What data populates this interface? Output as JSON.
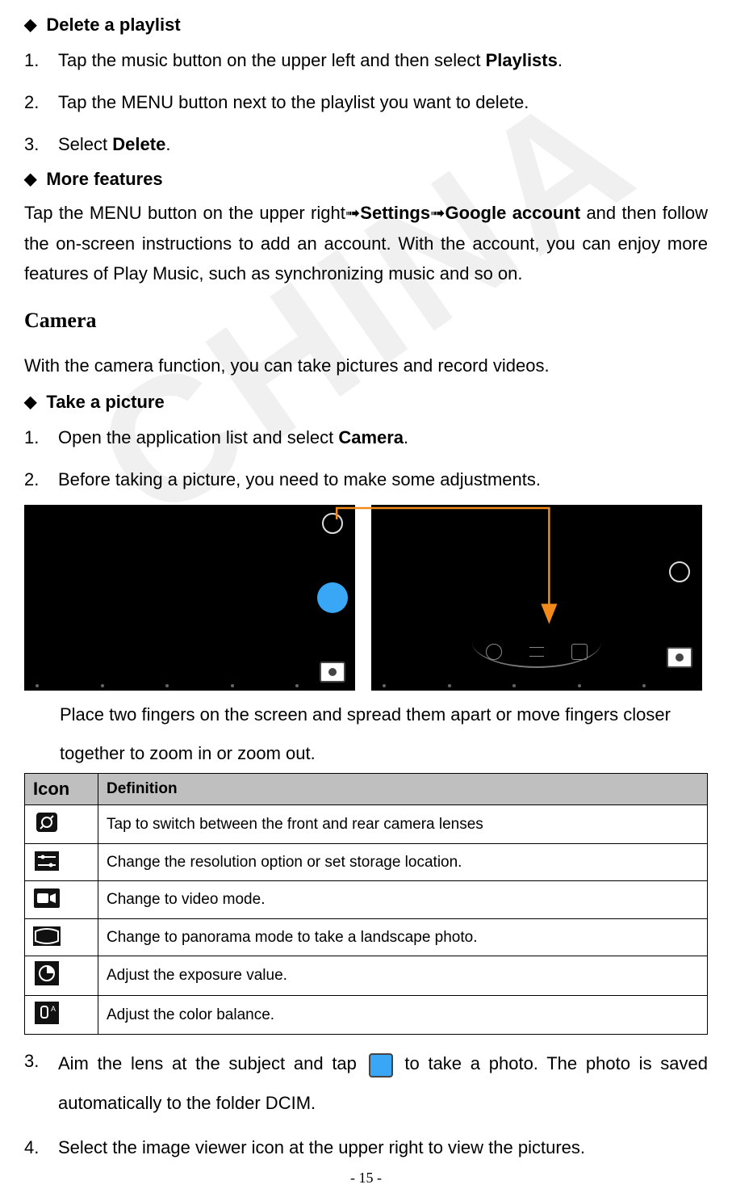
{
  "section_delete": {
    "title": "Delete a playlist",
    "steps": [
      {
        "num": "1.",
        "pre": "Tap the music button on the upper left and then select ",
        "bold": "Playlists",
        "post": "."
      },
      {
        "num": "2.",
        "pre": "Tap the MENU button next to the playlist you want to delete.",
        "bold": "",
        "post": ""
      },
      {
        "num": "3.",
        "pre": "Select ",
        "bold": "Delete",
        "post": "."
      }
    ]
  },
  "section_more": {
    "title": "More features",
    "para_pre": "Tap the MENU button on the upper right",
    "arrow": "➟",
    "b1": "Settings",
    "b2": "Google account",
    "para_post": " and then follow the on-screen instructions to add an account. With the account, you can enjoy more features of Play Music, such as synchronizing music and so on."
  },
  "section_camera": {
    "h": "Camera",
    "intro": "With the camera function, you can take pictures and record videos.",
    "take_title": "Take a picture",
    "steps": [
      {
        "num": "1.",
        "pre": "Open the application list and select ",
        "bold": "Camera",
        "post": "."
      },
      {
        "num": "2.",
        "pre": "Before taking a picture, you need to make some adjustments.",
        "bold": "",
        "post": ""
      }
    ],
    "zoom_note_l1": "Place two fingers on the screen and spread them apart or move fingers closer",
    "zoom_note_l2": "together to zoom in or zoom out.",
    "table": {
      "head_icon": "Icon",
      "head_def": "Definition",
      "rows": [
        {
          "icon": "switch-camera-icon",
          "def": "Tap to switch between the front and rear camera lenses"
        },
        {
          "icon": "settings-sliders-icon",
          "def": "Change the resolution option or set storage location."
        },
        {
          "icon": "video-mode-icon",
          "def": "Change to video mode."
        },
        {
          "icon": "panorama-mode-icon",
          "def": "Change to panorama mode to take a landscape photo."
        },
        {
          "icon": "exposure-icon",
          "def": "Adjust the exposure value."
        },
        {
          "icon": "white-balance-icon",
          "def": "Adjust the color balance."
        }
      ]
    },
    "step3_num": "3.",
    "step3_pre": "Aim the lens at the subject and tap ",
    "step3_post": " to take a photo. The photo is saved automatically to the folder DCIM.",
    "step4_num": "4.",
    "step4_text": "Select the image viewer icon at the upper right to view the pictures."
  },
  "page_number": "- 15 -"
}
